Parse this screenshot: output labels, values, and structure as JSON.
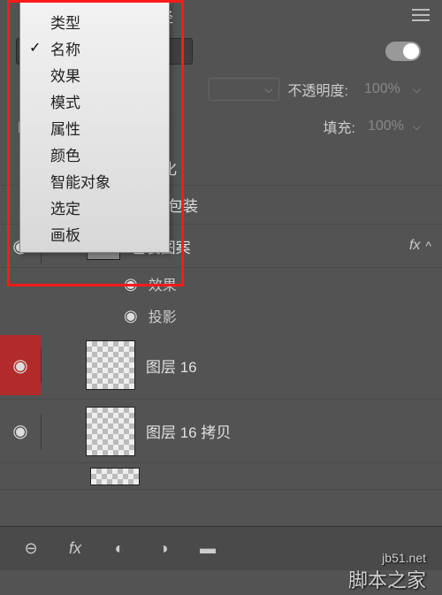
{
  "header": {
    "tab_paths": "路径"
  },
  "filter_menu": {
    "items": [
      "类型",
      "名称",
      "效果",
      "模式",
      "属性",
      "颜色",
      "智能对象",
      "选定",
      "画板"
    ],
    "checked_index": 1
  },
  "opacity": {
    "label": "不透明度:",
    "value": "100%"
  },
  "fill": {
    "label": "填充:",
    "value": "100%"
  },
  "effects": {
    "header": "锐化",
    "sub1": "塑料包装",
    "group_name": "包装图案",
    "fx_label": "fx",
    "fx_title": "效果",
    "fx_item": "投影"
  },
  "layers": {
    "l1_name": "图层 16",
    "l2_name": "图层 16 拷贝"
  },
  "watermark": {
    "url": "jb51.net",
    "text": "脚本之家"
  }
}
